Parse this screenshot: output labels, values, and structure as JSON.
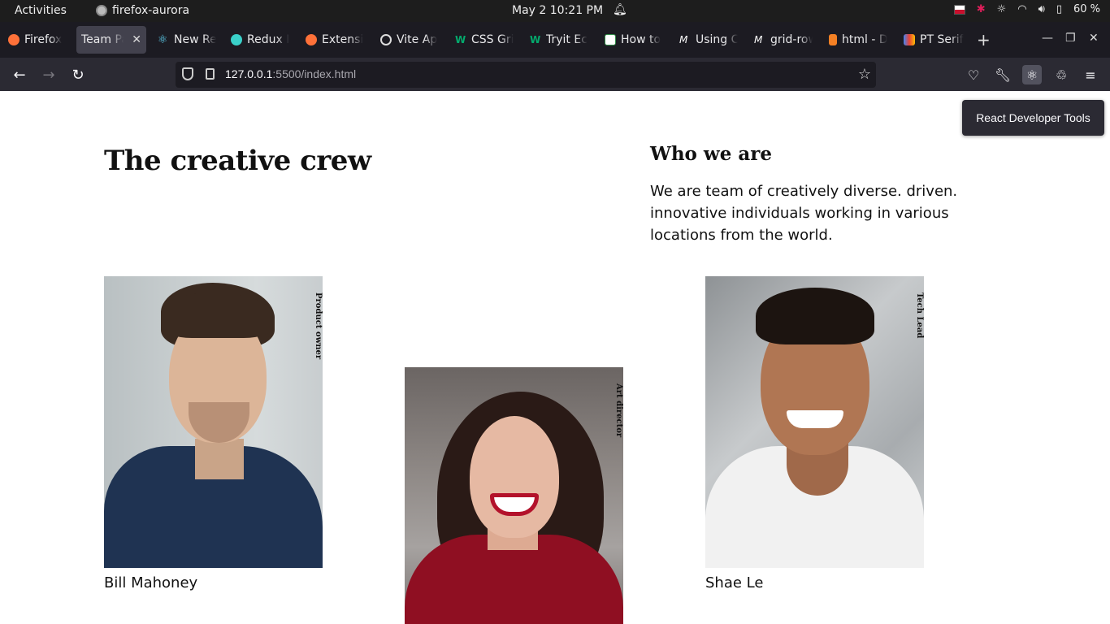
{
  "system": {
    "activities": "Activities",
    "app_name": "firefox-aurora",
    "clock": "May 2  10:21 PM",
    "battery": "60 %"
  },
  "tabs": [
    {
      "label": "Firefox",
      "icon": "firefox-icon",
      "color": "#ff7139"
    },
    {
      "label": "Team Pa",
      "icon": "",
      "active": true
    },
    {
      "label": "New Re",
      "icon": "react-icon",
      "color": "#61dafb"
    },
    {
      "label": "Redux I",
      "icon": "redux-icon",
      "color": "#3ad0c9"
    },
    {
      "label": "Extensi",
      "icon": "firefox-icon",
      "color": "#ff7139"
    },
    {
      "label": "Vite Ap",
      "icon": "info-icon",
      "color": "#dddddd"
    },
    {
      "label": "CSS Gri",
      "icon": "w3-icon",
      "color": "#04aa6d"
    },
    {
      "label": "Tryit Ec",
      "icon": "w3-icon",
      "color": "#04aa6d"
    },
    {
      "label": "How to",
      "icon": "gfg-icon",
      "color": "#2f8d46"
    },
    {
      "label": "Using C",
      "icon": "mdn-icon",
      "color": "#ffffff"
    },
    {
      "label": "grid-row",
      "icon": "mdn-icon",
      "color": "#ffffff"
    },
    {
      "label": "html - D",
      "icon": "stackoverflow-icon",
      "color": "#f48024"
    },
    {
      "label": "PT Serif",
      "icon": "google-fonts-icon",
      "color": "#4285f4"
    }
  ],
  "nav": {
    "url_host": "127.0.0.1",
    "url_path": ":5500/index.html"
  },
  "tooltip": "React Developer Tools",
  "page": {
    "title": "The creative crew",
    "who_title": "Who we are",
    "who_text": "We are team of creatively diverse. driven. innovative individuals working in various locations from the world.",
    "members": [
      {
        "name": "Bill Mahoney",
        "role": "Product owner"
      },
      {
        "name": "",
        "role": "Art director"
      },
      {
        "name": "Shae Le",
        "role": "Tech Lead"
      }
    ]
  },
  "colors": {
    "topbar": "#1d1d1d",
    "tabstrip": "#1c1b22",
    "navbar": "#2b2a33"
  }
}
